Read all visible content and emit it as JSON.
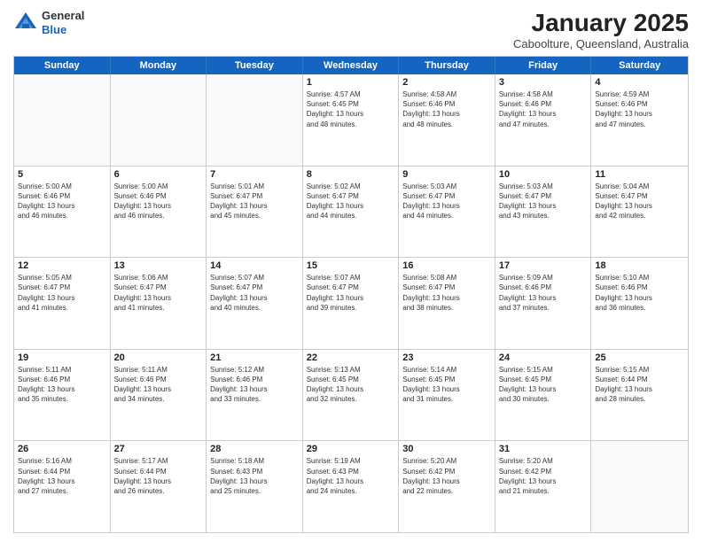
{
  "logo": {
    "general": "General",
    "blue": "Blue"
  },
  "title": "January 2025",
  "subtitle": "Caboolture, Queensland, Australia",
  "days": [
    "Sunday",
    "Monday",
    "Tuesday",
    "Wednesday",
    "Thursday",
    "Friday",
    "Saturday"
  ],
  "weeks": [
    [
      {
        "day": "",
        "info": ""
      },
      {
        "day": "",
        "info": ""
      },
      {
        "day": "",
        "info": ""
      },
      {
        "day": "1",
        "info": "Sunrise: 4:57 AM\nSunset: 6:45 PM\nDaylight: 13 hours\nand 48 minutes."
      },
      {
        "day": "2",
        "info": "Sunrise: 4:58 AM\nSunset: 6:46 PM\nDaylight: 13 hours\nand 48 minutes."
      },
      {
        "day": "3",
        "info": "Sunrise: 4:58 AM\nSunset: 6:46 PM\nDaylight: 13 hours\nand 47 minutes."
      },
      {
        "day": "4",
        "info": "Sunrise: 4:59 AM\nSunset: 6:46 PM\nDaylight: 13 hours\nand 47 minutes."
      }
    ],
    [
      {
        "day": "5",
        "info": "Sunrise: 5:00 AM\nSunset: 6:46 PM\nDaylight: 13 hours\nand 46 minutes."
      },
      {
        "day": "6",
        "info": "Sunrise: 5:00 AM\nSunset: 6:46 PM\nDaylight: 13 hours\nand 46 minutes."
      },
      {
        "day": "7",
        "info": "Sunrise: 5:01 AM\nSunset: 6:47 PM\nDaylight: 13 hours\nand 45 minutes."
      },
      {
        "day": "8",
        "info": "Sunrise: 5:02 AM\nSunset: 6:47 PM\nDaylight: 13 hours\nand 44 minutes."
      },
      {
        "day": "9",
        "info": "Sunrise: 5:03 AM\nSunset: 6:47 PM\nDaylight: 13 hours\nand 44 minutes."
      },
      {
        "day": "10",
        "info": "Sunrise: 5:03 AM\nSunset: 6:47 PM\nDaylight: 13 hours\nand 43 minutes."
      },
      {
        "day": "11",
        "info": "Sunrise: 5:04 AM\nSunset: 6:47 PM\nDaylight: 13 hours\nand 42 minutes."
      }
    ],
    [
      {
        "day": "12",
        "info": "Sunrise: 5:05 AM\nSunset: 6:47 PM\nDaylight: 13 hours\nand 41 minutes."
      },
      {
        "day": "13",
        "info": "Sunrise: 5:06 AM\nSunset: 6:47 PM\nDaylight: 13 hours\nand 41 minutes."
      },
      {
        "day": "14",
        "info": "Sunrise: 5:07 AM\nSunset: 6:47 PM\nDaylight: 13 hours\nand 40 minutes."
      },
      {
        "day": "15",
        "info": "Sunrise: 5:07 AM\nSunset: 6:47 PM\nDaylight: 13 hours\nand 39 minutes."
      },
      {
        "day": "16",
        "info": "Sunrise: 5:08 AM\nSunset: 6:47 PM\nDaylight: 13 hours\nand 38 minutes."
      },
      {
        "day": "17",
        "info": "Sunrise: 5:09 AM\nSunset: 6:46 PM\nDaylight: 13 hours\nand 37 minutes."
      },
      {
        "day": "18",
        "info": "Sunrise: 5:10 AM\nSunset: 6:46 PM\nDaylight: 13 hours\nand 36 minutes."
      }
    ],
    [
      {
        "day": "19",
        "info": "Sunrise: 5:11 AM\nSunset: 6:46 PM\nDaylight: 13 hours\nand 35 minutes."
      },
      {
        "day": "20",
        "info": "Sunrise: 5:11 AM\nSunset: 6:46 PM\nDaylight: 13 hours\nand 34 minutes."
      },
      {
        "day": "21",
        "info": "Sunrise: 5:12 AM\nSunset: 6:46 PM\nDaylight: 13 hours\nand 33 minutes."
      },
      {
        "day": "22",
        "info": "Sunrise: 5:13 AM\nSunset: 6:45 PM\nDaylight: 13 hours\nand 32 minutes."
      },
      {
        "day": "23",
        "info": "Sunrise: 5:14 AM\nSunset: 6:45 PM\nDaylight: 13 hours\nand 31 minutes."
      },
      {
        "day": "24",
        "info": "Sunrise: 5:15 AM\nSunset: 6:45 PM\nDaylight: 13 hours\nand 30 minutes."
      },
      {
        "day": "25",
        "info": "Sunrise: 5:15 AM\nSunset: 6:44 PM\nDaylight: 13 hours\nand 28 minutes."
      }
    ],
    [
      {
        "day": "26",
        "info": "Sunrise: 5:16 AM\nSunset: 6:44 PM\nDaylight: 13 hours\nand 27 minutes."
      },
      {
        "day": "27",
        "info": "Sunrise: 5:17 AM\nSunset: 6:44 PM\nDaylight: 13 hours\nand 26 minutes."
      },
      {
        "day": "28",
        "info": "Sunrise: 5:18 AM\nSunset: 6:43 PM\nDaylight: 13 hours\nand 25 minutes."
      },
      {
        "day": "29",
        "info": "Sunrise: 5:19 AM\nSunset: 6:43 PM\nDaylight: 13 hours\nand 24 minutes."
      },
      {
        "day": "30",
        "info": "Sunrise: 5:20 AM\nSunset: 6:42 PM\nDaylight: 13 hours\nand 22 minutes."
      },
      {
        "day": "31",
        "info": "Sunrise: 5:20 AM\nSunset: 6:42 PM\nDaylight: 13 hours\nand 21 minutes."
      },
      {
        "day": "",
        "info": ""
      }
    ]
  ]
}
